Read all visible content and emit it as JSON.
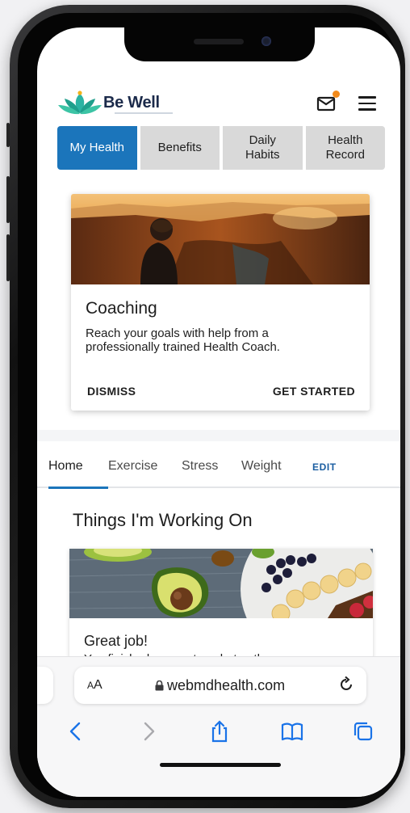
{
  "app": {
    "name": "Be Well"
  },
  "header": {
    "mail_icon": "mail-icon",
    "has_notification": true,
    "menu_icon": "menu-icon"
  },
  "tabs": [
    {
      "label": "My Health",
      "active": true
    },
    {
      "label": "Benefits",
      "active": false
    },
    {
      "label": "Daily\nHabits",
      "active": false
    },
    {
      "label": "Health\nRecord",
      "active": false
    }
  ],
  "coaching_card": {
    "title": "Coaching",
    "description": "Reach your goals with help from a professionally trained Health Coach.",
    "dismiss_label": "DISMISS",
    "start_label": "GET STARTED"
  },
  "subtabs": {
    "items": [
      "Home",
      "Exercise",
      "Stress",
      "Weight"
    ],
    "active": "Home",
    "edit_label": "EDIT"
  },
  "section_title": "Things I'm Working On",
  "working_card": {
    "title": "Great job!",
    "truncated_text": "You finished your ... to ... hat ... the"
  },
  "safari": {
    "text_size_label": "AA",
    "url": "webmdhealth.com",
    "icons": [
      "back-icon",
      "forward-icon",
      "share-icon",
      "bookmarks-icon",
      "tabs-icon"
    ]
  },
  "colors": {
    "accent": "#1b75bb",
    "notification": "#f28a1a",
    "brand_green": "#2bb3a3"
  }
}
